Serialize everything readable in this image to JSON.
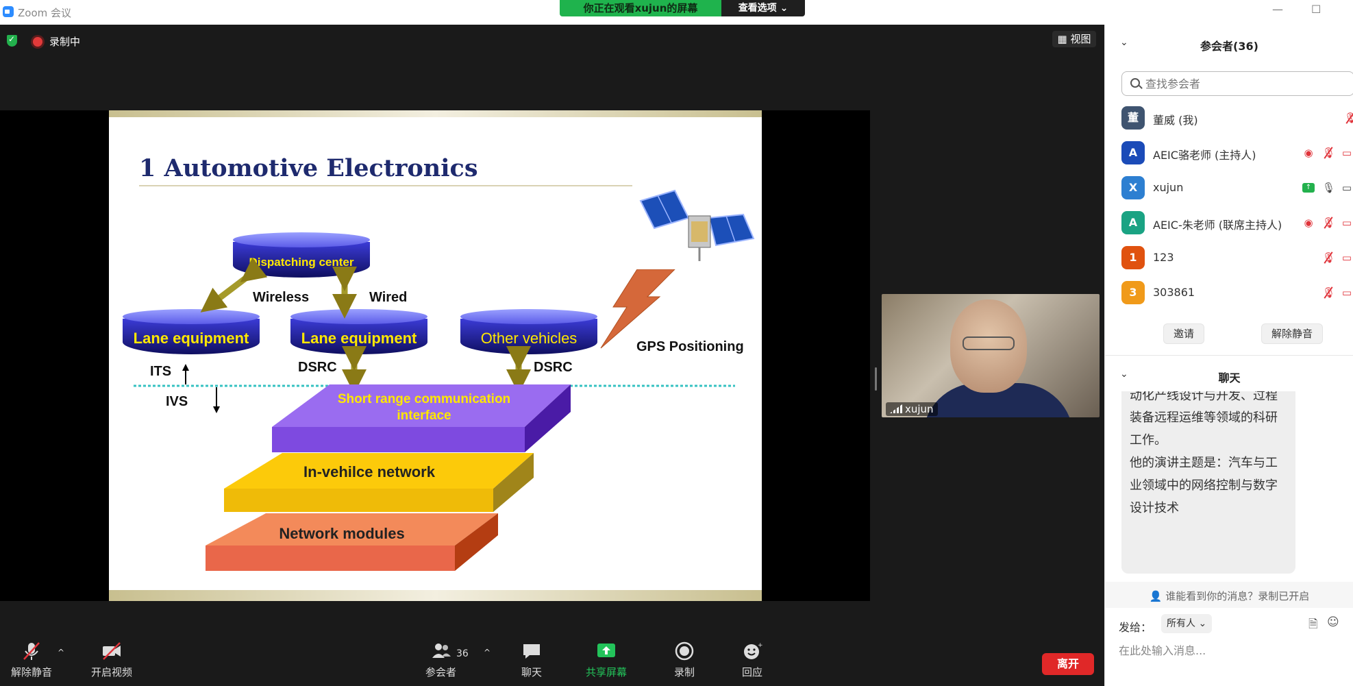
{
  "window": {
    "app_title": "Zoom 会议",
    "share_banner": "你正在观看xujun的屏幕",
    "view_options": "查看选项",
    "minimize": "—",
    "maximize": "☐"
  },
  "meeting": {
    "recording_label": "录制中",
    "view_button": "视图"
  },
  "slide": {
    "title": "1 Automotive Electronics",
    "cylinders": {
      "dispatching": "Dispatching center",
      "lane1": "Lane equipment",
      "lane2": "Lane equipment",
      "other": "Other vehicles"
    },
    "labels": {
      "wireless": "Wireless",
      "wired": "Wired",
      "dsrc_left": "DSRC",
      "dsrc_right": "DSRC",
      "gps": "GPS Positioning",
      "its": "ITS",
      "ivs": "IVS"
    },
    "layers": {
      "short_range_1": "Short range communication",
      "short_range_2": "interface",
      "in_vehicle": "In-vehilce network",
      "network_modules": "Network modules"
    }
  },
  "video": {
    "name": "xujun"
  },
  "toolbar": {
    "unmute": "解除静音",
    "start_video": "开启视频",
    "participants": "参会者",
    "participants_count": "36",
    "chat": "聊天",
    "share_screen": "共享屏幕",
    "record": "录制",
    "reactions": "回应",
    "leave": "离开"
  },
  "panel": {
    "participants_title": "参会者(36)",
    "search_placeholder": "查找参会者",
    "participants": [
      {
        "name": "董威 (我)",
        "avatar": "董",
        "color": "#3f5470"
      },
      {
        "name": "AEIC骆老师 (主持人)",
        "avatar": "A",
        "color": "#1b4bb8"
      },
      {
        "name": "xujun",
        "avatar": "X",
        "color": "#2d7fd1"
      },
      {
        "name": "AEIC-朱老师 (联席主持人)",
        "avatar": "A",
        "color": "#1aa383"
      },
      {
        "name": "123",
        "avatar": "1",
        "color": "#e0520f"
      },
      {
        "name": "303861",
        "avatar": "3",
        "color": "#f09a1a"
      }
    ],
    "invite": "邀请",
    "unmute_all": "解除静音",
    "chat_title": "聊天",
    "chat_lines": [
      "动化产线设计与开发、过程",
      "装备远程运维等领域的科研",
      "工作。",
      "他的演讲主题是：汽车与工",
      "业领域中的网络控制与数字",
      "设计技术"
    ],
    "privacy_note": "谁能看到你的消息？录制已开启",
    "send_to_label": "发给：",
    "send_to_value": "所有人",
    "message_placeholder": "在此处输入消息..."
  }
}
